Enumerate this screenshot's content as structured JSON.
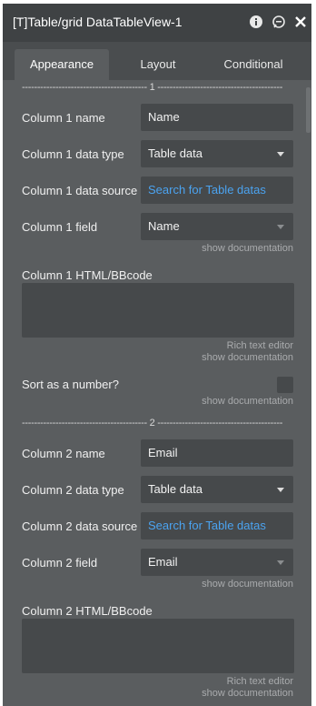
{
  "header": {
    "title": "[T]Table/grid DataTableView-1",
    "icons": [
      "info-icon",
      "comment-icon",
      "close-icon"
    ]
  },
  "tabs": [
    {
      "label": "Appearance",
      "active": true
    },
    {
      "label": "Layout",
      "active": false
    },
    {
      "label": "Conditional",
      "active": false
    }
  ],
  "sections": {
    "s1": "----------------------------------------- 1 -----------------------------------------",
    "s2": "----------------------------------------- 2 -----------------------------------------"
  },
  "col1": {
    "name_label": "Column 1 name",
    "name_value": "Name",
    "type_label": "Column 1 data type",
    "type_value": "Table data",
    "source_label": "Column 1 data source",
    "source_value": "Search for Table datas",
    "field_label": "Column 1 field",
    "field_value": "Name",
    "field_doc": "show documentation",
    "html_label": "Column 1 HTML/BBcode",
    "rich_text": "Rich text editor",
    "html_doc": "show documentation",
    "sort_label": "Sort as a number?",
    "sort_doc": "show documentation"
  },
  "col2": {
    "name_label": "Column 2 name",
    "name_value": "Email",
    "type_label": "Column 2 data type",
    "type_value": "Table data",
    "source_label": "Column 2 data source",
    "source_value": "Search for Table datas",
    "field_label": "Column 2 field",
    "field_value": "Email",
    "field_doc": "show documentation",
    "html_label": "Column 2 HTML/BBcode",
    "rich_text": "Rich text editor",
    "html_doc": "show documentation"
  },
  "colors": {
    "panel": "#5a5d5f",
    "titlebar": "#3f4244",
    "field": "#46494b",
    "link": "#4ba3f0"
  }
}
